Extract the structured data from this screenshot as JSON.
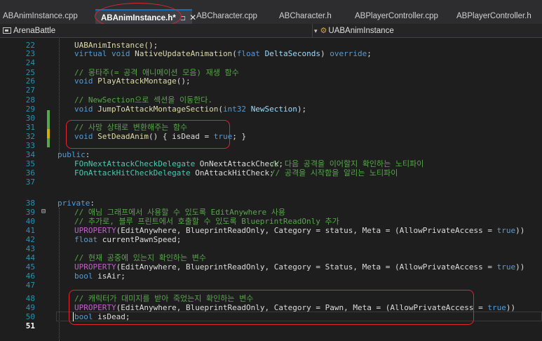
{
  "tabs": [
    {
      "label": "ABAnimInstance.cpp",
      "active": false
    },
    {
      "label": "ABAnimInstance.h*",
      "active": true
    },
    {
      "label": "ABCharacter.cpp",
      "active": false
    },
    {
      "label": "ABCharacter.h",
      "active": false
    },
    {
      "label": "ABPlayerController.cpp",
      "active": false
    },
    {
      "label": "ABPlayerController.h",
      "active": false
    }
  ],
  "tab_pin_icon": "pin-icon",
  "tab_close_glyph": "✕",
  "navbar": {
    "project": "ArenaBattle",
    "class": "UABAnimInstance",
    "dropdown_glyph": "▾"
  },
  "editor": {
    "current_line": 51,
    "line_numbers": [
      22,
      23,
      24,
      25,
      26,
      27,
      28,
      29,
      30,
      31,
      32,
      33,
      34,
      35,
      36,
      37,
      38,
      39,
      40,
      41,
      42,
      43,
      44,
      45,
      46,
      47,
      48,
      49,
      50,
      51
    ],
    "fold_glyph": "⊟",
    "lines": {
      "l22": "UABAnimInstance();",
      "l23_a": "virtual",
      "l23_b": "void",
      "l23_c": "NativeUpdateAnimation",
      "l23_d": "(",
      "l23_e": "float",
      "l23_f": "DeltaSeconds",
      "l23_g": ") ",
      "l23_h": "override",
      "l23_i": ";",
      "l25": "// 몽타주(= 공격 애니메이션 모음) 재생 함수",
      "l26_a": "void",
      "l26_b": "PlayAttackMontage",
      "l26_c": "();",
      "l28": "// NewSection으로 섹션을 이동한다.",
      "l29_a": "void",
      "l29_b": "JumpToAttackMontageSection",
      "l29_c": "(",
      "l29_d": "int32",
      "l29_e": "NewSection",
      "l29_f": ");",
      "l31": "// 사망 상태로 변환해주는 함수",
      "l32_a": "void",
      "l32_b": "SetDeadAnim",
      "l32_c": "() { isDead = ",
      "l32_d": "true",
      "l32_e": "; }",
      "l34_a": "public",
      "l34_b": ":",
      "l35_a": "FOnNextAttackCheckDelegate",
      "l35_b": " OnNextAttackCheck;",
      "l35_c": "// 다음 공격을 이어할지 확인하는 노티파이",
      "l36_a": "FOnAttackHitCheckDelegate",
      "l36_b": " OnAttackHitCheck;",
      "l36_c": "// 공격을 시작함을 알리는 노티파이",
      "l38_a": "private",
      "l38_b": ":",
      "l39": "// 애님 그래프에서 사용할 수 있도록 EditAnywhere 사용",
      "l40": "// 추가로, 블루 프린트에서 호출할 수 있도록 BlueprintReadOnly 추가",
      "l41_a": "UPROPERTY",
      "l41_b": "(EditAnywhere, BlueprintReadOnly, Category = status, Meta = (AllowPrivateAccess = ",
      "l41_c": "true",
      "l41_d": "))",
      "l42_a": "float",
      "l42_b": " currentPawnSpeed;",
      "l44": "// 현재 공중에 있는지 확인하는 변수",
      "l45_a": "UPROPERTY",
      "l45_b": "(EditAnywhere, BlueprintReadOnly, Category = Status, Meta = (AllowPrivateAccess = ",
      "l45_c": "true",
      "l45_d": "))",
      "l46_a": "bool",
      "l46_b": " isAir;",
      "l48": "// 캐릭터가 대미지를 받아 죽었는지 확인하는 변수",
      "l49_a": "UPROPERTY",
      "l49_b": "(EditAnywhere, BlueprintReadOnly, Category = Pawn, Meta = (AllowPrivateAccess = ",
      "l49_c": "true",
      "l49_d": "))",
      "l50_a": "bool",
      "l50_b": " isDead;"
    }
  },
  "colors": {
    "background": "#1e1e1e",
    "keyword": "#569cd6",
    "type": "#4ec9b0",
    "function": "#dcdcaa",
    "macro": "#bd63c5",
    "comment": "#57a64a",
    "line_number": "#2b91af",
    "annotation": "#e0262d",
    "active_tab_accent": "#0e70c0"
  }
}
